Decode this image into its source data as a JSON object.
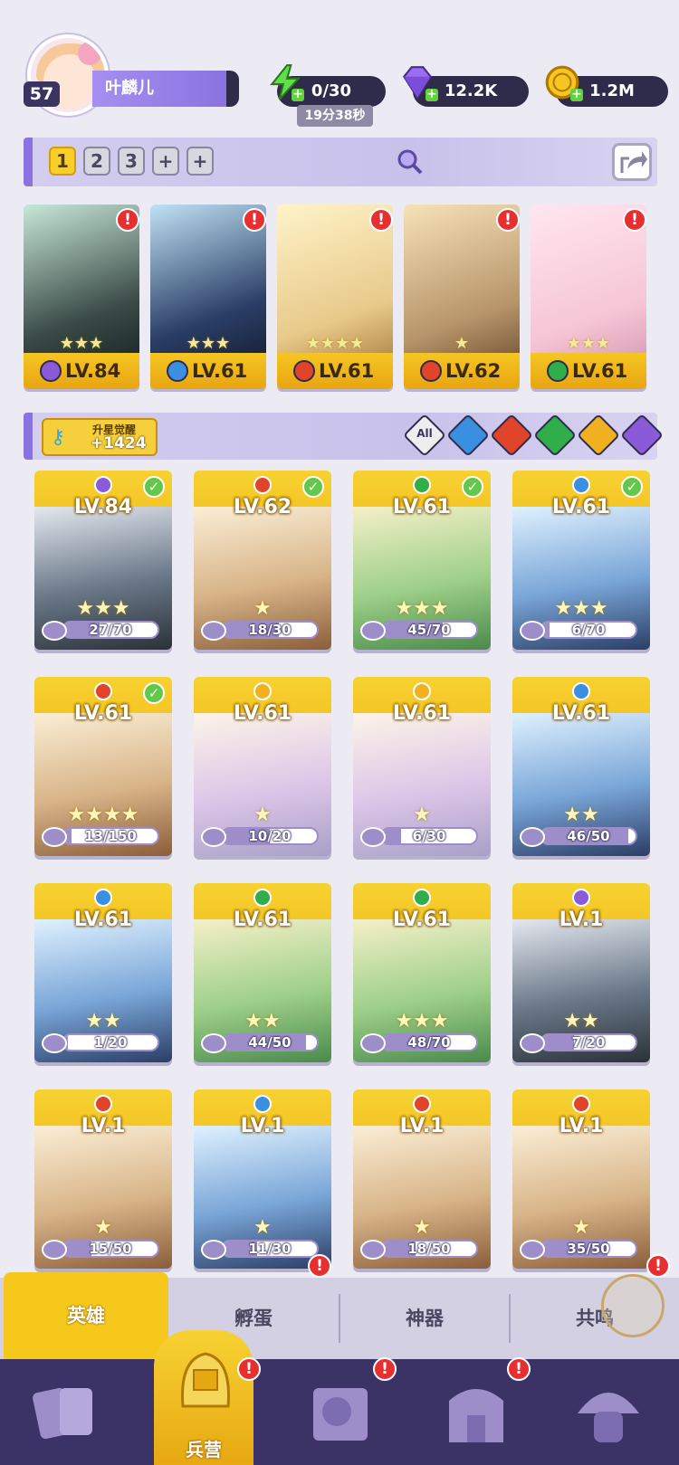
{
  "player": {
    "level": "57",
    "name": "叶麟儿"
  },
  "resources": {
    "energy": "0/30",
    "energy_timer": "19分38秒",
    "gems": "12.2K",
    "coins": "1.2M"
  },
  "team": {
    "pages": [
      "1",
      "2",
      "3",
      "+",
      "+"
    ],
    "active_page": "1",
    "members": [
      {
        "level": "LV.84",
        "stars": "★★★",
        "element": "dark",
        "alert": "!"
      },
      {
        "level": "LV.61",
        "stars": "★★★",
        "element": "water",
        "alert": "!"
      },
      {
        "level": "LV.61",
        "stars": "★★★★",
        "element": "fire",
        "alert": "!"
      },
      {
        "level": "LV.62",
        "stars": "★",
        "element": "fire",
        "alert": "!"
      },
      {
        "level": "LV.61",
        "stars": "★★★",
        "element": "wind",
        "alert": "!"
      }
    ]
  },
  "star_awaken": {
    "label": "升星觉醒",
    "count": "+1424"
  },
  "filters": {
    "all_label": "All",
    "elements": [
      "water",
      "fire",
      "wind",
      "light",
      "dark"
    ]
  },
  "heroes": [
    {
      "level": "LV.84",
      "element": "dark",
      "checked": true,
      "stars": "★★★",
      "progress": "27/70",
      "ratio": 0.386
    },
    {
      "level": "LV.62",
      "element": "fire",
      "checked": true,
      "stars": "★",
      "progress": "18/30",
      "ratio": 0.6
    },
    {
      "level": "LV.61",
      "element": "wind",
      "checked": true,
      "stars": "★★★",
      "progress": "45/70",
      "ratio": 0.643
    },
    {
      "level": "LV.61",
      "element": "water",
      "checked": true,
      "stars": "★★★",
      "progress": "6/70",
      "ratio": 0.086
    },
    {
      "level": "LV.61",
      "element": "fire",
      "checked": true,
      "stars": "★★★★",
      "progress": "13/150",
      "ratio": 0.087
    },
    {
      "level": "LV.61",
      "element": "light",
      "checked": false,
      "stars": "★",
      "progress": "10/20",
      "ratio": 0.5
    },
    {
      "level": "LV.61",
      "element": "light",
      "checked": false,
      "stars": "★",
      "progress": "6/30",
      "ratio": 0.2
    },
    {
      "level": "LV.61",
      "element": "water",
      "checked": false,
      "stars": "★★",
      "progress": "46/50",
      "ratio": 0.92
    },
    {
      "level": "LV.61",
      "element": "water",
      "checked": false,
      "stars": "★★",
      "progress": "1/20",
      "ratio": 0.05
    },
    {
      "level": "LV.61",
      "element": "wind",
      "checked": false,
      "stars": "★★",
      "progress": "44/50",
      "ratio": 0.88
    },
    {
      "level": "LV.61",
      "element": "wind",
      "checked": false,
      "stars": "★★★",
      "progress": "48/70",
      "ratio": 0.686
    },
    {
      "level": "LV.1",
      "element": "dark",
      "checked": false,
      "stars": "★★",
      "progress": "7/20",
      "ratio": 0.35
    },
    {
      "level": "LV.1",
      "element": "fire",
      "checked": false,
      "stars": "★",
      "progress": "15/50",
      "ratio": 0.3
    },
    {
      "level": "LV.1",
      "element": "water",
      "checked": false,
      "stars": "★",
      "progress": "11/30",
      "ratio": 0.367
    },
    {
      "level": "LV.1",
      "element": "fire",
      "checked": false,
      "stars": "★",
      "progress": "18/50",
      "ratio": 0.36
    },
    {
      "level": "LV.1",
      "element": "fire",
      "checked": false,
      "stars": "★",
      "progress": "35/50",
      "ratio": 0.7
    }
  ],
  "tabs": [
    {
      "label": "英雄",
      "active": true,
      "alert": ""
    },
    {
      "label": "孵蛋",
      "active": false,
      "alert": "!"
    },
    {
      "label": "神器",
      "active": false,
      "alert": ""
    },
    {
      "label": "共鸣",
      "active": false,
      "alert": "!"
    }
  ],
  "bottom_nav": {
    "barracks_label": "兵营",
    "alert": "!"
  },
  "colors": {
    "dark": "#8a5ad8",
    "water": "#3a8fe0",
    "fire": "#e0442a",
    "wind": "#2fae4a",
    "light": "#f0b020",
    "gold": "#f7c81c",
    "purple": "#8a73e0"
  }
}
